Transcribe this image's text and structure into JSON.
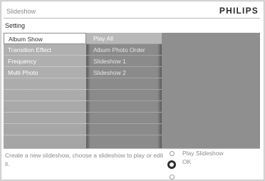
{
  "header": {
    "title": "Slideshow",
    "brand": "PHILIPS"
  },
  "section": {
    "label": "Setting"
  },
  "menu": {
    "items": [
      {
        "label": "Album Show",
        "selected": true
      },
      {
        "label": "Transition Effect",
        "selected": false
      },
      {
        "label": "Frequency",
        "selected": false
      },
      {
        "label": "Multi Photo",
        "selected": false
      }
    ]
  },
  "submenu": {
    "items": [
      {
        "label": "Play All",
        "selected": true
      },
      {
        "label": "Album Photo Order",
        "selected": false
      },
      {
        "label": "Slideshow 1",
        "selected": false
      },
      {
        "label": "Slideshow 2",
        "selected": false
      }
    ]
  },
  "footer": {
    "help": "Create a new slideshow, choose a slideshow to play or edit it.",
    "actions": {
      "play": "Play Slideshow",
      "ok": "OK"
    }
  },
  "colors": {
    "panel": "#a8a8a8",
    "selected_bg": "#ffffff",
    "brand": "#2a2a2a"
  }
}
